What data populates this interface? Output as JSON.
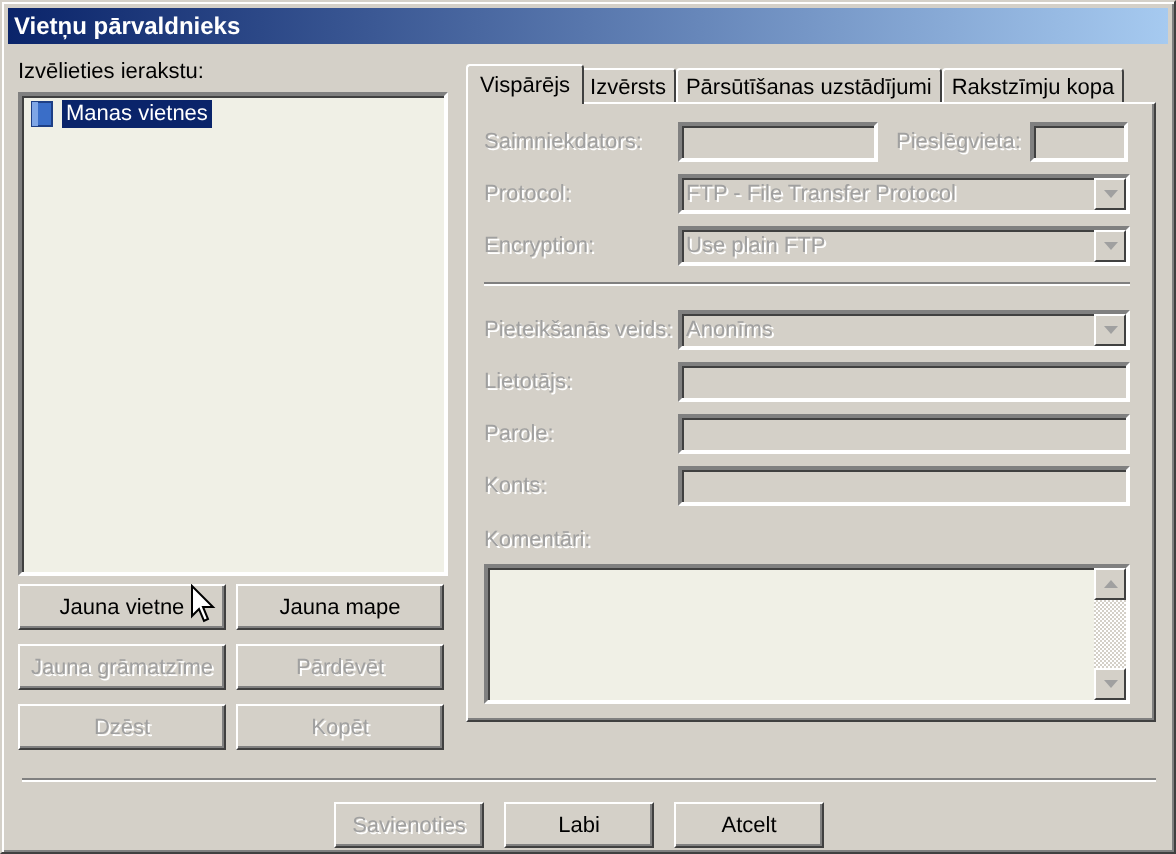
{
  "window": {
    "title": "Vietņu pārvaldnieks"
  },
  "site_list": {
    "label": "Izvēlieties ierakstu:",
    "items": [
      {
        "label": "Manas vietnes",
        "selected": true
      }
    ]
  },
  "left_buttons": [
    {
      "label": "Jauna vietne",
      "disabled": false
    },
    {
      "label": "Jauna mape",
      "disabled": false
    },
    {
      "label": "Jauna grāmatzīme",
      "disabled": true
    },
    {
      "label": "Pārdēvēt",
      "disabled": true
    },
    {
      "label": "Dzēst",
      "disabled": true
    },
    {
      "label": "Kopēt",
      "disabled": true
    }
  ],
  "tabs": [
    {
      "label": "Vispārējs",
      "selected": true
    },
    {
      "label": "Izvērsts",
      "selected": false
    },
    {
      "label": "Pārsūtīšanas uzstādījumi",
      "selected": false
    },
    {
      "label": "Rakstzīmju kopa",
      "selected": false
    }
  ],
  "fields": [
    {
      "kind": "host",
      "label": "Saimniekdators:",
      "port_label": "Pieslēgvieta:",
      "disabled": true
    },
    {
      "kind": "select",
      "label": "Protocol:",
      "value": "FTP - File Transfer Protocol",
      "disabled": true
    },
    {
      "kind": "select",
      "label": "Encryption:",
      "value": "Use plain FTP",
      "disabled": true
    },
    {
      "kind": "separator"
    },
    {
      "kind": "select",
      "label": "Pieteikšanās veids:",
      "value": "Anonīms",
      "disabled": true
    },
    {
      "kind": "text",
      "label": "Lietotājs:",
      "disabled": true
    },
    {
      "kind": "text",
      "label": "Parole:",
      "disabled": true
    },
    {
      "kind": "text",
      "label": "Konts:",
      "disabled": true
    }
  ],
  "comments": {
    "label": "Komentāri:",
    "disabled": true
  },
  "bottom_buttons": [
    {
      "label": "Savienoties",
      "disabled": true
    },
    {
      "label": "Labi",
      "disabled": false
    },
    {
      "label": "Atcelt",
      "disabled": false
    }
  ]
}
